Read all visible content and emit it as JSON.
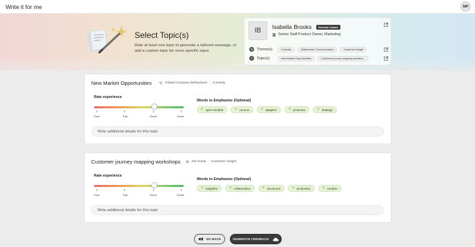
{
  "app": {
    "title": "Write it for me",
    "user_initials": "MP"
  },
  "hero": {
    "title": "Select Topic(s)",
    "subtitle": "Rate at least one topic to generate a tailored message, or add a custom topic for more specific input."
  },
  "profile": {
    "initials": "IB",
    "name": "Isabella Brooks",
    "badge": "External Contact",
    "role": "Senior Staff Product Owner, Marketing",
    "themes_num": "8",
    "themes_label": "Theme(s)",
    "themes": [
      "Curiosity",
      "Stakeholder Communication",
      "Customer Insight"
    ],
    "topics_num": "7",
    "topics_label": "Topic(s)",
    "topics": [
      "New Market Opportunities",
      "Customer journey mapping worksho..."
    ]
  },
  "rating_labels": [
    "Poor",
    "Fair",
    "Good",
    "Great"
  ],
  "topics": [
    {
      "title": "New Market Opportunities",
      "crumb_icon": "wifi-icon",
      "crumb_parent": "Global Company Behaviours",
      "crumb_child": "Curiosity",
      "rate_label": "Rate experience",
      "rating": 0.67,
      "emphasize_label": "Words to Emphasize (Optional)",
      "words": [
        "open-minded",
        "curious",
        "adaptive",
        "proactive",
        "strategic"
      ],
      "details_placeholder": "Write additional details for this topic"
    },
    {
      "title": "Customer journey mapping workshops",
      "crumb_icon": "cross-icon",
      "crumb_parent": "Job Areas",
      "crumb_child": "Customer Insight",
      "rate_label": "Rate experience",
      "rating": 0.67,
      "emphasize_label": "Words to Emphasize (Optional)",
      "words": [
        "insightful",
        "collaborative",
        "structured",
        "productive",
        "creative"
      ],
      "details_placeholder": "Write additional details for this topic"
    }
  ],
  "actions": {
    "back_label": "GO BACK",
    "generate_label": "GENERATE FEEDBACK"
  }
}
